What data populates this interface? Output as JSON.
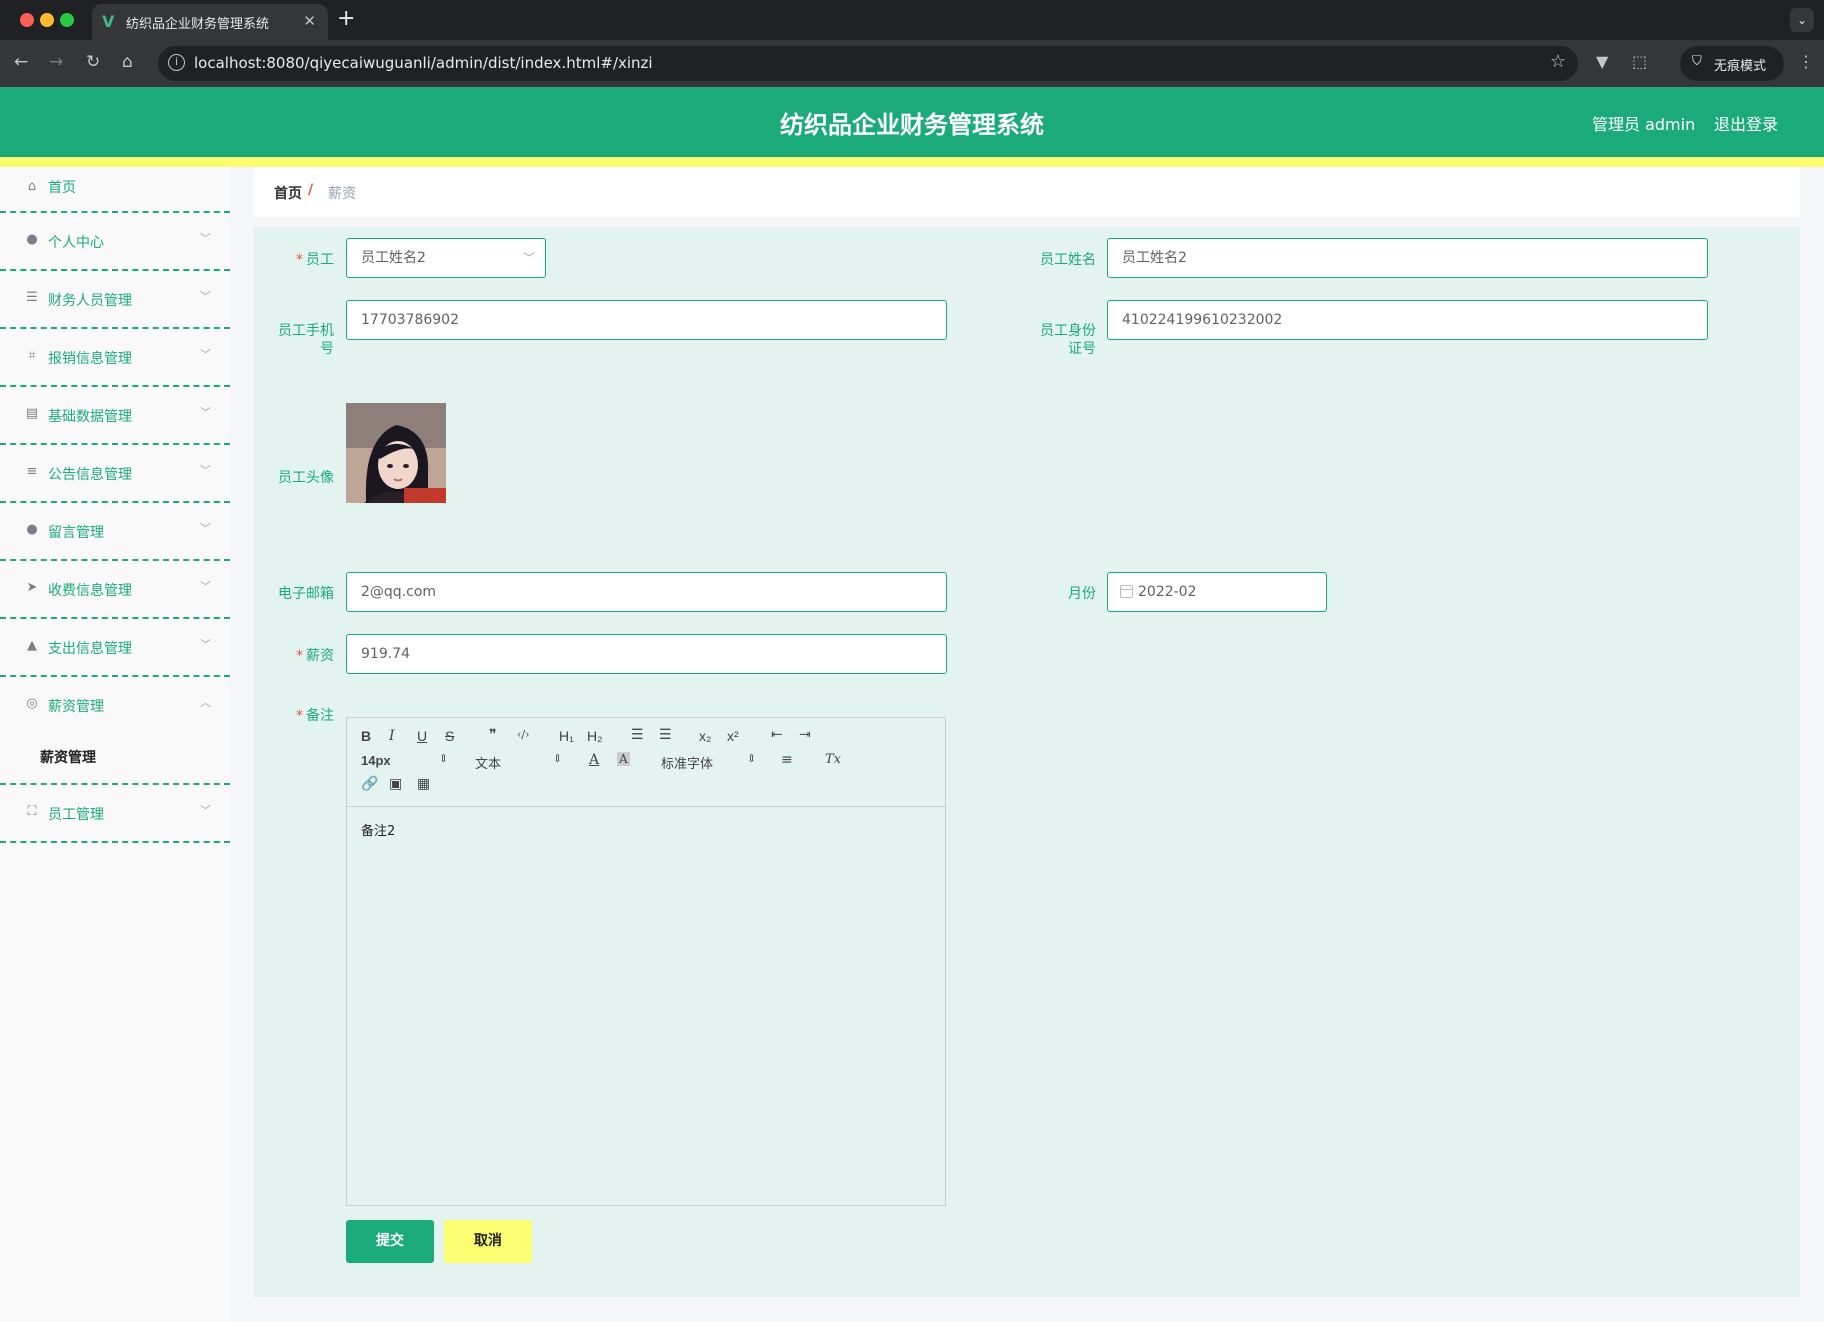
{
  "browser": {
    "tab_title": "纺织品企业财务管理系统",
    "url": "localhost:8080/qiyecaiwuguanli/admin/dist/index.html#/xinzi",
    "incognito_label": "无痕模式"
  },
  "header": {
    "title": "纺织品企业财务管理系统",
    "admin_label": "管理员 admin",
    "logout_label": "退出登录"
  },
  "sidebar": {
    "items": [
      {
        "label": "首页",
        "icon": "home-icon"
      },
      {
        "label": "个人中心",
        "icon": "user-icon"
      },
      {
        "label": "财务人员管理",
        "icon": "sliders-icon"
      },
      {
        "label": "报销信息管理",
        "icon": "crop-icon"
      },
      {
        "label": "基础数据管理",
        "icon": "clipboard-icon"
      },
      {
        "label": "公告信息管理",
        "icon": "list-icon"
      },
      {
        "label": "留言管理",
        "icon": "user-icon"
      },
      {
        "label": "收费信息管理",
        "icon": "send-icon"
      },
      {
        "label": "支出信息管理",
        "icon": "stamp-icon"
      },
      {
        "label": "薪资管理",
        "icon": "compass-icon"
      },
      {
        "label": "员工管理",
        "icon": "fullscreen-icon"
      }
    ],
    "submenu": {
      "label": "薪资管理"
    }
  },
  "breadcrumb": {
    "home": "首页",
    "separator": "/",
    "current": "薪资"
  },
  "form": {
    "employee": {
      "label": "员工",
      "value": "员工姓名2"
    },
    "employee_name": {
      "label": "员工姓名",
      "value": "员工姓名2"
    },
    "phone": {
      "label_line1": "员工手机",
      "label_line2": "号",
      "value": "17703786902"
    },
    "id_card": {
      "label_line1": "员工身份",
      "label_line2": "证号",
      "value": "410224199610232002"
    },
    "avatar": {
      "label": "员工头像"
    },
    "email": {
      "label": "电子邮箱",
      "value": "2@qq.com"
    },
    "month": {
      "label": "月份",
      "value": "2022-02"
    },
    "salary": {
      "label": "薪资",
      "value": "919.74"
    },
    "remark": {
      "label": "备注",
      "content": "备注2"
    },
    "required_mark": "*"
  },
  "editor_toolbar": {
    "bold": "B",
    "italic": "I",
    "underline": "U",
    "strike": "S",
    "quote": "❞",
    "code": "‹/›",
    "h1": "H₁",
    "h2": "H₂",
    "ordered_list": "☰",
    "bullet_list": "☰",
    "subscript": "x₂",
    "superscript": "x²",
    "outdent": "⇤",
    "indent": "⇥",
    "size": "14px",
    "header": "文本",
    "font": "标准字体",
    "align": "≡",
    "clean": "Tx"
  },
  "buttons": {
    "submit": "提交",
    "cancel": "取消"
  },
  "colors": {
    "primary": "#1bab7a",
    "accent_yellow": "#fbfd70",
    "form_bg": "#e3f3ef",
    "required": "#e5543e"
  }
}
